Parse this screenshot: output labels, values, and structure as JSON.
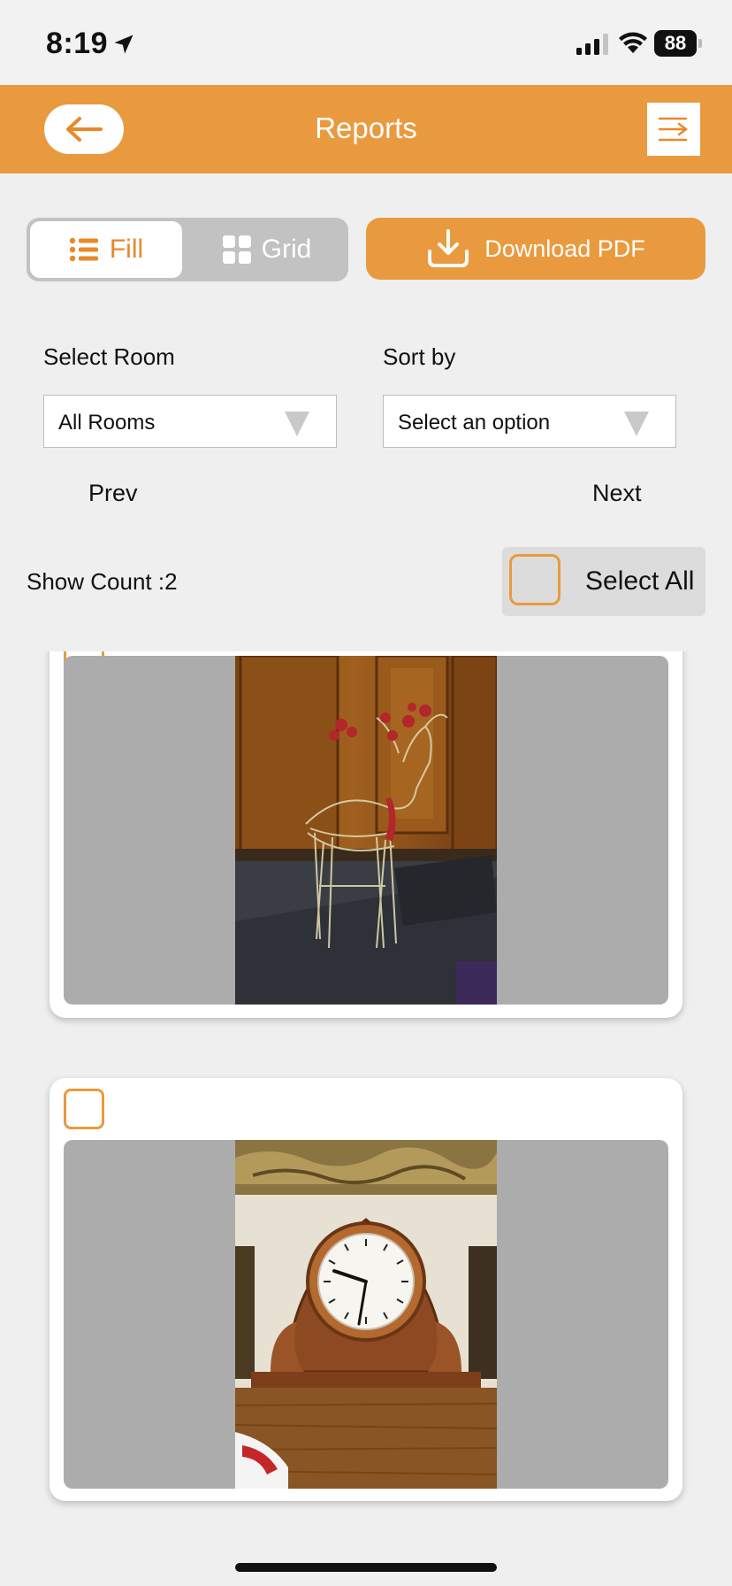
{
  "status_bar": {
    "time": "8:19",
    "battery": "88",
    "icons": [
      "location-arrow-icon",
      "cellular-signal-icon",
      "wifi-icon",
      "battery-icon"
    ]
  },
  "header": {
    "title": "Reports",
    "back_icon": "arrow-left-icon",
    "menu_icon": "menu-collapse-icon",
    "color": "#ea9a3e"
  },
  "view_toggle": {
    "fill_label": "Fill",
    "grid_label": "Grid",
    "selected": "Fill"
  },
  "download": {
    "label": "Download PDF",
    "icon": "download-icon"
  },
  "filters": {
    "room_label": "Select Room",
    "room_value": "All Rooms",
    "sort_label": "Sort by",
    "sort_value": "Select an option"
  },
  "pager": {
    "prev": "Prev",
    "next": "Next"
  },
  "list_controls": {
    "show_count": "Show Count :2",
    "select_all": "Select All"
  },
  "items": [
    {
      "photo_subject": "reindeer-wire-figure-photo",
      "checked": false
    },
    {
      "photo_subject": "mantel-clock-photo",
      "checked": false
    }
  ],
  "colors": {
    "accent": "#ea9a3e",
    "accent_text": "#e8882a",
    "background": "#efefef"
  }
}
